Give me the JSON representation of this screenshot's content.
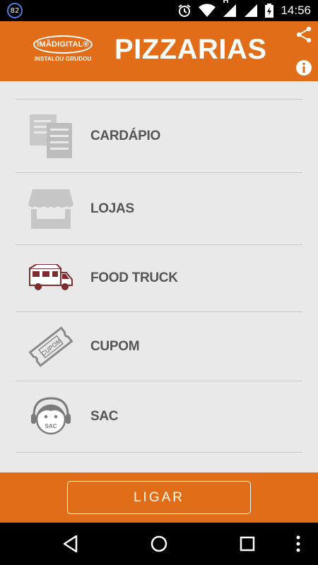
{
  "status_bar": {
    "notification_count": "82",
    "network_type": "H",
    "time": "14:56",
    "icons": [
      "notification-badge-icon",
      "alarm-icon",
      "wifi-icon",
      "signal-icon",
      "signal-icon",
      "battery-charging-icon"
    ]
  },
  "header": {
    "brand_name": "IMÃDIGITAL®",
    "brand_tagline": "INSTALOU GRUDOU",
    "title": "PIZZARIAS",
    "actions": [
      "share-icon",
      "info-icon"
    ],
    "color": "#e26d18"
  },
  "menu": {
    "items": [
      {
        "label": "CARDÁPIO",
        "icon": "menu-documents-icon"
      },
      {
        "label": "LOJAS",
        "icon": "storefront-icon"
      },
      {
        "label": "FOOD TRUCK",
        "icon": "food-truck-icon"
      },
      {
        "label": "CUPOM",
        "icon": "coupon-ticket-icon"
      },
      {
        "label": "SAC",
        "icon": "customer-service-headset-icon"
      }
    ]
  },
  "action": {
    "call_label": "LIGAR"
  },
  "nav": [
    "back-icon",
    "home-icon",
    "recents-icon",
    "overflow-menu-icon"
  ],
  "colors": {
    "accent": "#e26d18",
    "list_background": "#e9e9e9",
    "label_text": "#555555"
  },
  "truck_label": "CUPOM",
  "sac_icon_text": "SAC"
}
